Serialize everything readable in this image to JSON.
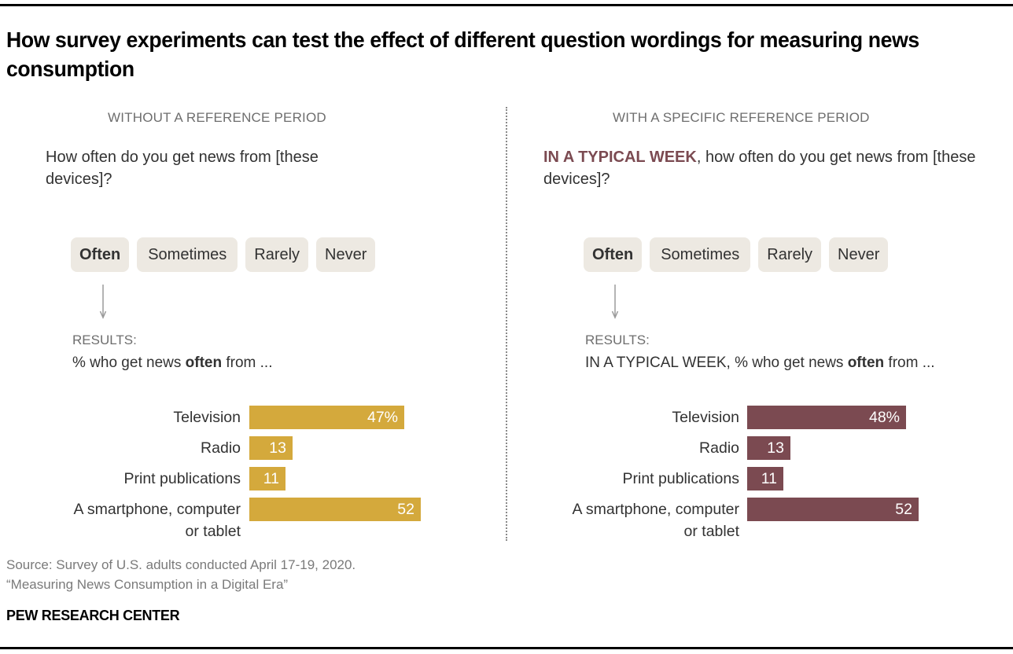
{
  "title": "How survey experiments can test the effect of different question wordings for measuring news consumption",
  "colors": {
    "gold": "#d4a93c",
    "maroon": "#7b4a51",
    "chip_bg": "#ede9e2"
  },
  "panels": [
    {
      "heading": "WITHOUT A REFERENCE PERIOD",
      "question_accent": "",
      "question_text": "How often do you get news from [these devices]?",
      "choices": [
        "Often",
        "Sometimes",
        "Rarely",
        "Never"
      ],
      "selected_choice": "Often",
      "results_label": "RESULTS:",
      "results_prefix": "% who get news ",
      "results_bold": "often",
      "results_suffix": " from ..."
    },
    {
      "heading": "WITH A SPECIFIC REFERENCE PERIOD",
      "question_accent": "IN A TYPICAL WEEK",
      "question_text": ", how often do you get news from [these devices]?",
      "choices": [
        "Often",
        "Sometimes",
        "Rarely",
        "Never"
      ],
      "selected_choice": "Often",
      "results_label": "RESULTS:",
      "results_prefix": "IN A TYPICAL WEEK, % who get news ",
      "results_bold": "often",
      "results_suffix": " from ..."
    }
  ],
  "chart_data": [
    {
      "type": "bar",
      "orientation": "horizontal",
      "title": "% who get news often from ...",
      "categories": [
        "Television",
        "Radio",
        "Print publications",
        "A smartphone, computer or tablet"
      ],
      "category_lines": [
        [
          "Television"
        ],
        [
          "Radio"
        ],
        [
          "Print publications"
        ],
        [
          "A smartphone, computer",
          "or tablet"
        ]
      ],
      "values": [
        47,
        13,
        11,
        52
      ],
      "value_labels": [
        "47%",
        "13",
        "11",
        "52"
      ],
      "color": "#d4a93c",
      "xlim": [
        0,
        100
      ],
      "grid": false
    },
    {
      "type": "bar",
      "orientation": "horizontal",
      "title": "IN A TYPICAL WEEK, % who get news often from ...",
      "categories": [
        "Television",
        "Radio",
        "Print publications",
        "A smartphone, computer or tablet"
      ],
      "category_lines": [
        [
          "Television"
        ],
        [
          "Radio"
        ],
        [
          "Print publications"
        ],
        [
          "A smartphone, computer",
          "or tablet"
        ]
      ],
      "values": [
        48,
        13,
        11,
        52
      ],
      "value_labels": [
        "48%",
        "13",
        "11",
        "52"
      ],
      "color": "#7b4a51",
      "xlim": [
        0,
        100
      ],
      "grid": false
    }
  ],
  "footer": {
    "source_line1": "Source: Survey of U.S. adults conducted April 17-19, 2020.",
    "source_line2": "“Measuring News Consumption in a Digital Era”",
    "brand": "PEW RESEARCH CENTER"
  }
}
